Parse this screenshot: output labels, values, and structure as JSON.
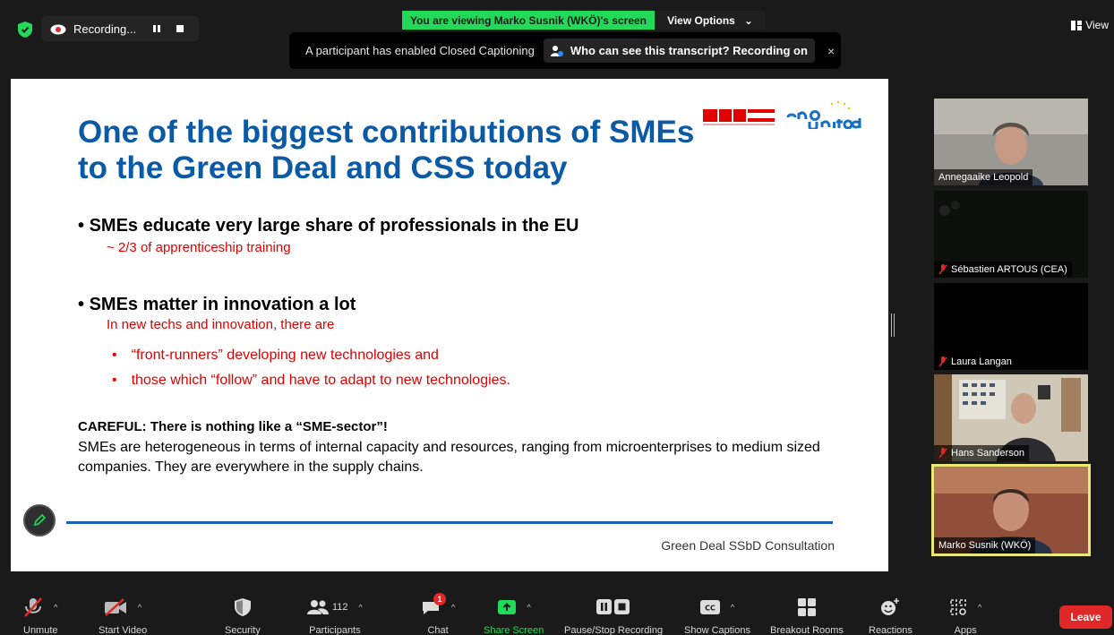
{
  "top": {
    "recording_label": "Recording...",
    "viewing_banner": "You are viewing Marko Susnik (WKÖ)'s screen",
    "view_options": "View Options",
    "view_label": "View"
  },
  "cc_banner": {
    "message": "A participant has enabled Closed Captioning",
    "who_button": "Who can see this transcript? Recording on",
    "close": "×"
  },
  "slide": {
    "title": "One of the biggest contributions of SMEs to the Green Deal and CSS today",
    "logo_wko": "WKO",
    "logo_smeunited": "smeunited",
    "bullet1": "SMEs educate very large share of professionals in the EU",
    "bullet1_sub": "~ 2/3 of apprenticeship training",
    "bullet2": "SMEs matter in innovation a lot",
    "bullet2_sub": "In new techs and innovation, there are",
    "subbullets": [
      "“front-runners” developing new technologies and",
      "those which “follow” and have to adapt to new technologies."
    ],
    "careful_heading": "CAREFUL: There is nothing like a “SME-sector”!",
    "careful_text": "SMEs are heterogeneous in terms of internal capacity and resources, ranging from microenterprises to medium sized companies. They are everywhere in the supply chains.",
    "footer": "Green Deal SSbD Consultation"
  },
  "participants": [
    {
      "name": "Annegaaike Leopold",
      "muted": false
    },
    {
      "name": "Sébastien ARTOUS  (CEA)",
      "muted": true
    },
    {
      "name": "Laura Langan",
      "muted": true
    },
    {
      "name": "Hans Sanderson",
      "muted": true
    },
    {
      "name": "Marko Susnik (WKÖ)",
      "muted": false
    }
  ],
  "toolbar": {
    "unmute": "Unmute",
    "start_video": "Start Video",
    "security": "Security",
    "participants": "Participants",
    "participant_count": "112",
    "chat": "Chat",
    "chat_badge": "1",
    "share_screen": "Share Screen",
    "pause_recording": "Pause/Stop Recording",
    "show_captions": "Show Captions",
    "breakout_rooms": "Breakout Rooms",
    "reactions": "Reactions",
    "apps": "Apps",
    "leave": "Leave"
  },
  "colors": {
    "share_green": "#23d959",
    "leave_red": "#e02828",
    "title_blue": "#0a5aa6",
    "accent_red": "#e00000",
    "active_speaker_border": "#e9e97a"
  }
}
